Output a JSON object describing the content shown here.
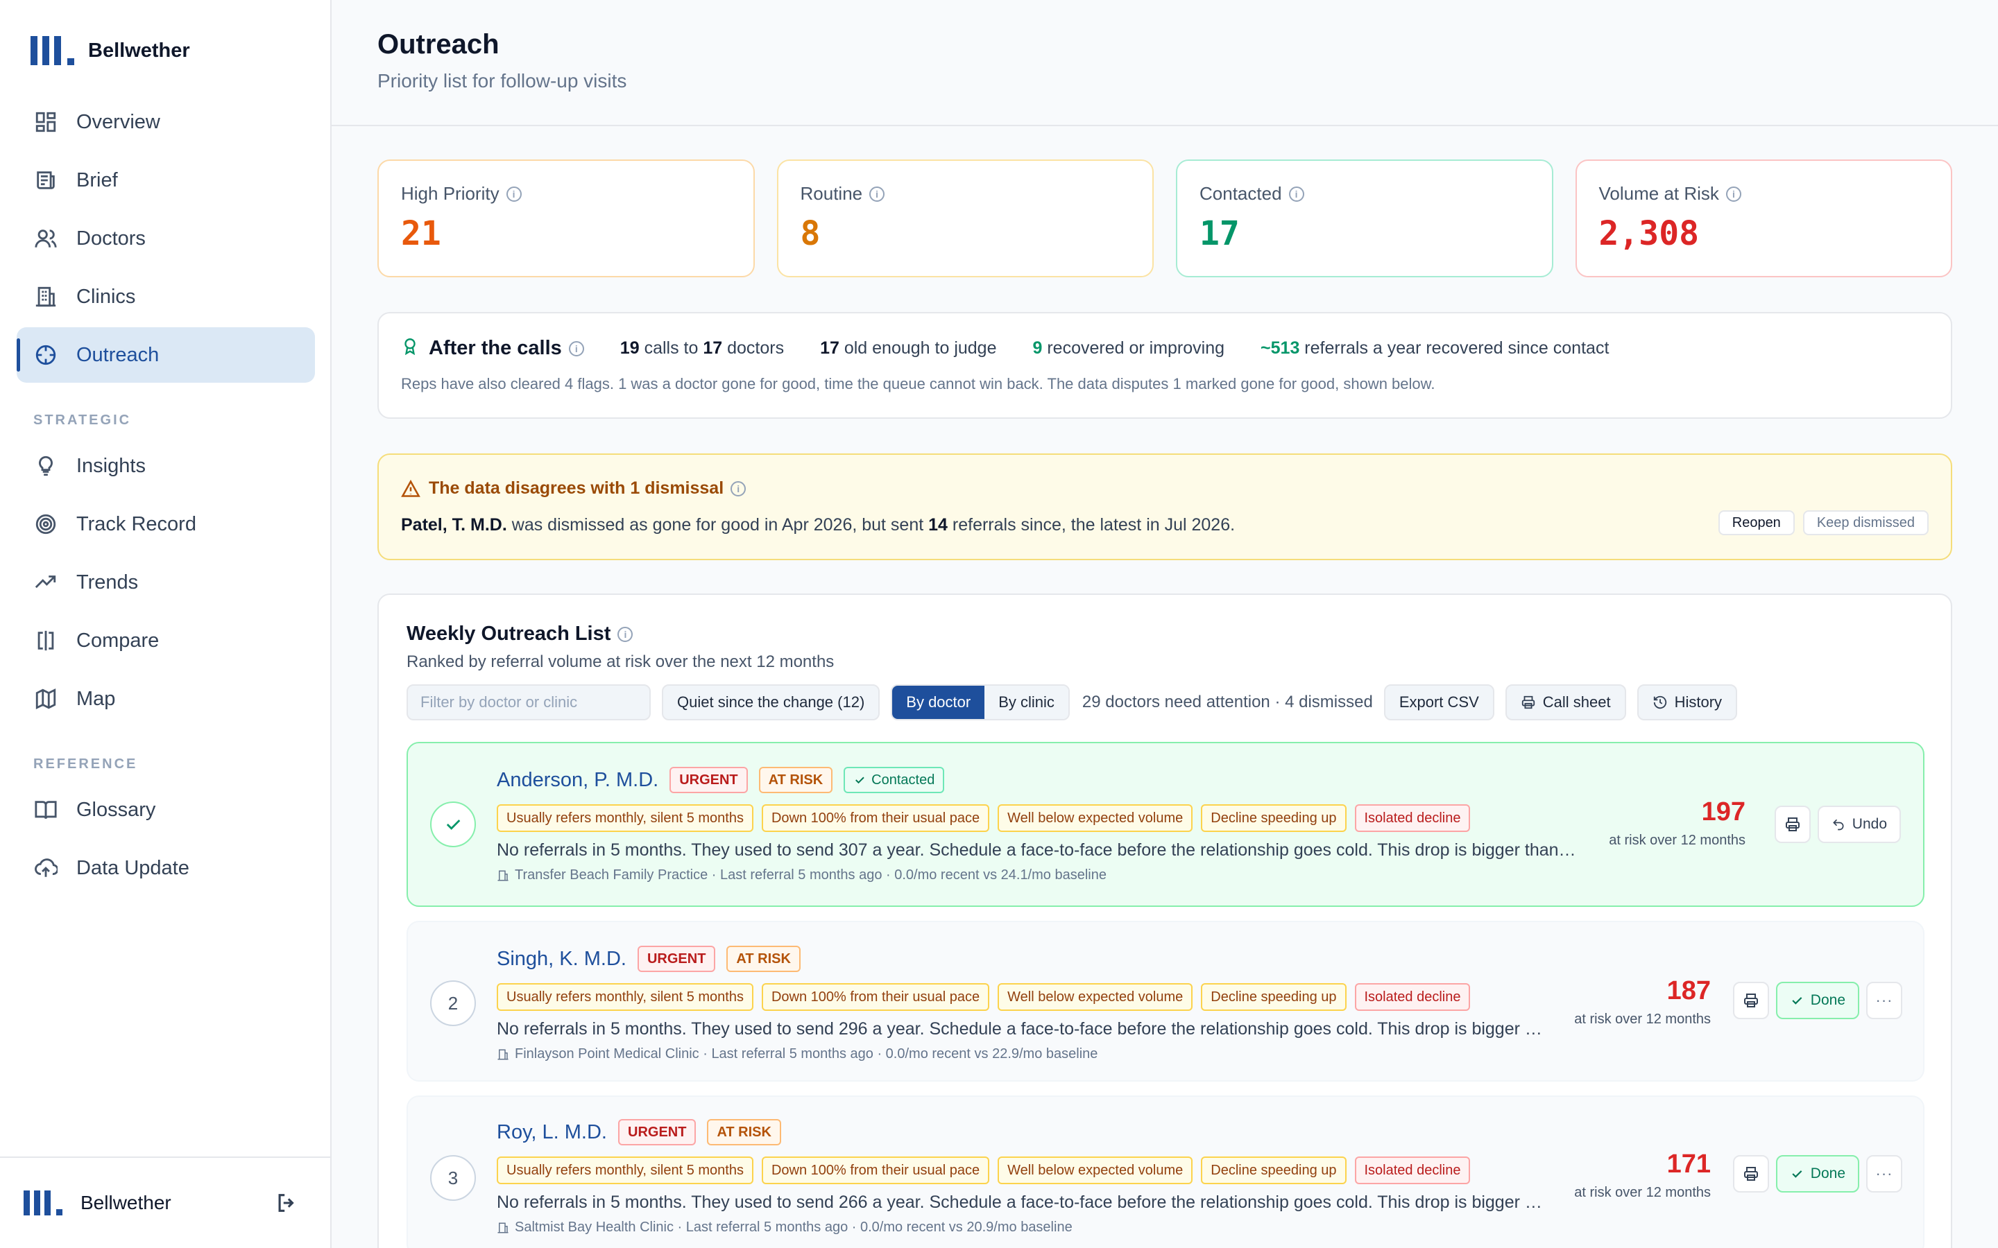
{
  "brand": {
    "name": "Bellwether"
  },
  "nav": {
    "items": [
      {
        "label": "Overview",
        "icon": "dashboard-icon"
      },
      {
        "label": "Brief",
        "icon": "newspaper-icon"
      },
      {
        "label": "Doctors",
        "icon": "users-icon"
      },
      {
        "label": "Clinics",
        "icon": "building-icon"
      },
      {
        "label": "Outreach",
        "icon": "crosshair-icon",
        "active": true
      }
    ],
    "strategic_heading": "STRATEGIC",
    "strategic": [
      {
        "label": "Insights",
        "icon": "lightbulb-icon"
      },
      {
        "label": "Track Record",
        "icon": "target-icon"
      },
      {
        "label": "Trends",
        "icon": "trending-up-icon"
      },
      {
        "label": "Compare",
        "icon": "compare-icon"
      },
      {
        "label": "Map",
        "icon": "map-icon"
      }
    ],
    "reference_heading": "REFERENCE",
    "reference": [
      {
        "label": "Glossary",
        "icon": "book-icon"
      },
      {
        "label": "Data Update",
        "icon": "cloud-upload-icon"
      }
    ]
  },
  "footer": {
    "name": "Bellwether"
  },
  "header": {
    "title": "Outreach",
    "subtitle": "Priority list for follow-up visits"
  },
  "kpis": [
    {
      "label": "High Priority",
      "value": "21",
      "color": "#e8590c",
      "border": "#fcd9a8"
    },
    {
      "label": "Routine",
      "value": "8",
      "color": "#d97706",
      "border": "#fbe3a4"
    },
    {
      "label": "Contacted",
      "value": "17",
      "color": "#059669",
      "border": "#a7ecd4"
    },
    {
      "label": "Volume at Risk",
      "value": "2,308",
      "color": "#dc2626",
      "border": "#fbc4c4"
    }
  ],
  "after_calls": {
    "title": "After the calls",
    "calls": "19",
    "calls_text": "calls to",
    "doctors": "17",
    "doctors_text": "doctors",
    "judge": "17",
    "judge_text": "old enough to judge",
    "recovered": "9",
    "recovered_text": "recovered or improving",
    "referrals": "~513",
    "referrals_text": "referrals a year recovered since contact",
    "note": "Reps have also cleared 4 flags. 1 was a doctor gone for good, time the queue cannot win back. The data disputes 1 marked gone for good, shown below."
  },
  "dispute": {
    "title": "The data disagrees with 1 dismissal",
    "name": "Patel, T. M.D.",
    "text_a": "was dismissed as gone for good in Apr 2026, but sent",
    "count": "14",
    "text_b": "referrals since, the latest in Jul 2026.",
    "reopen": "Reopen",
    "keep": "Keep dismissed"
  },
  "list": {
    "title": "Weekly Outreach List",
    "subtitle": "Ranked by referral volume at risk over the next 12 months",
    "filter_placeholder": "Filter by doctor or clinic",
    "quiet": "Quiet since the change (12)",
    "by_doctor": "By doctor",
    "by_clinic": "By clinic",
    "status": "29 doctors need attention · 4 dismissed",
    "export": "Export CSV",
    "call_sheet": "Call sheet",
    "history": "History",
    "risk_label": "at risk over 12 months",
    "rows": [
      {
        "rank": "",
        "name": "Anderson, P. M.D.",
        "urgent": "URGENT",
        "risk": "AT RISK",
        "contacted": "Contacted",
        "tags": [
          "Usually refers monthly, silent 5 months",
          "Down 100% from their usual pace",
          "Well below expected volume",
          "Decline speeding up",
          "Isolated decline"
        ],
        "desc": "No referrals in 5 months. They used to send 307 a year. Schedule a face-to-face before the relationship goes cold. This drop is bigger than usual for this doctor.",
        "meta": "Transfer Beach Family Practice · Last referral 5 months ago · 0.0/mo recent vs 24.1/mo baseline",
        "value": "197",
        "action": "Undo"
      },
      {
        "rank": "2",
        "name": "Singh, K. M.D.",
        "urgent": "URGENT",
        "risk": "AT RISK",
        "tags": [
          "Usually refers monthly, silent 5 months",
          "Down 100% from their usual pace",
          "Well below expected volume",
          "Decline speeding up",
          "Isolated decline"
        ],
        "desc": "No referrals in 5 months. They used to send 296 a year. Schedule a face-to-face before the relationship goes cold. This drop is bigger than usual for this doctor.",
        "meta": "Finlayson Point Medical Clinic · Last referral 5 months ago · 0.0/mo recent vs 22.9/mo baseline",
        "value": "187",
        "action": "Done"
      },
      {
        "rank": "3",
        "name": "Roy, L. M.D.",
        "urgent": "URGENT",
        "risk": "AT RISK",
        "tags": [
          "Usually refers monthly, silent 5 months",
          "Down 100% from their usual pace",
          "Well below expected volume",
          "Decline speeding up",
          "Isolated decline"
        ],
        "desc": "No referrals in 5 months. They used to send 266 a year. Schedule a face-to-face before the relationship goes cold. This drop is bigger than usual for this doctor.",
        "meta": "Saltmist Bay Health Clinic · Last referral 5 months ago · 0.0/mo recent vs 20.9/mo baseline",
        "value": "171",
        "action": "Done"
      }
    ]
  }
}
